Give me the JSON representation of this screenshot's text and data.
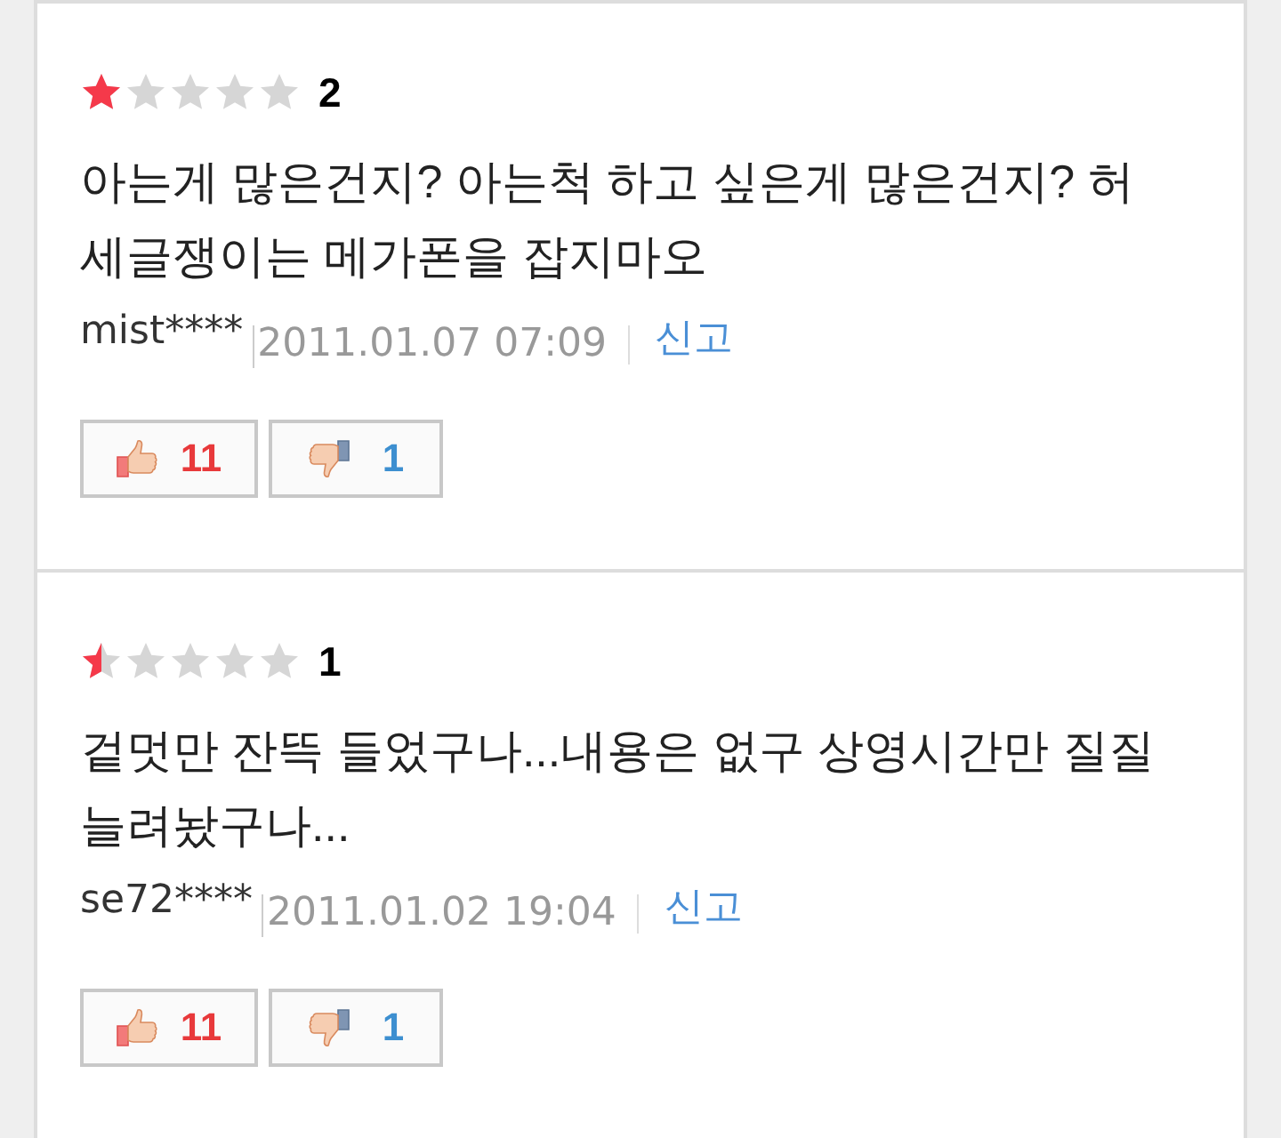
{
  "reviews": [
    {
      "stars": 1,
      "score": "2",
      "text": "아는게 많은건지? 아는척 하고 싶은게 많은건지? 허세글쟁이는 메가폰을 잡지마오",
      "author": "mist****",
      "date": "2011.01.07 07:09",
      "report": "신고",
      "likes": "11",
      "dislikes": "1"
    },
    {
      "stars": 0.5,
      "score": "1",
      "text": "겉멋만 잔뜩 들었구나...내용은 없구 상영시간만 질질 늘려놨구나...",
      "author": "se72****",
      "date": "2011.01.02 19:04",
      "report": "신고",
      "likes": "11",
      "dislikes": "1"
    }
  ]
}
